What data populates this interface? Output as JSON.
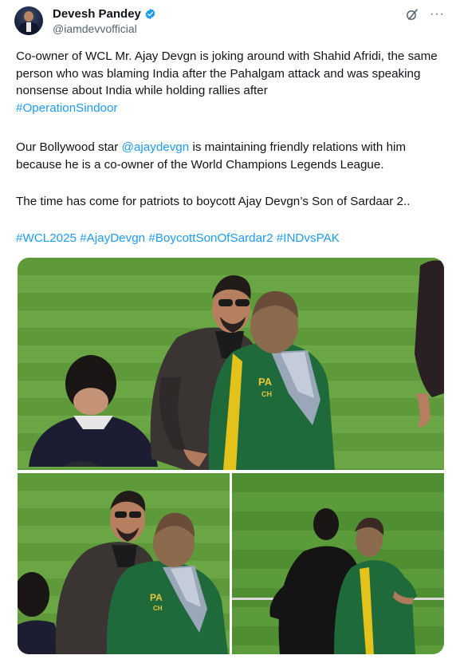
{
  "author": {
    "name": "Devesh Pandey",
    "handle": "@iamdevvofficial",
    "verified_icon": "verified-badge-icon",
    "colors": {
      "verified": "#1d9bf0",
      "link": "#1d9bf0",
      "text": "#0f1419",
      "muted": "#536471"
    }
  },
  "header_actions": {
    "grok_icon": "grok-icon",
    "more_label": "···"
  },
  "tweet": {
    "p1_text": "Co-owner of WCL Mr. Ajay Devgn is joking around with Shahid Afridi, the same person who was blaming India after the Pahalgam attack and was speaking nonsense about India while holding rallies after",
    "p1_tag": "#OperationSindoor",
    "p2_pre": "Our Bollywood star",
    "p2_mention": "@ajaydevgn",
    "p2_post": "is maintaining friendly relations with him because he is a co-owner of the World Champions Legends League.",
    "p3_text": "The time has come for patriots to boycott Ajay Devgn’s Son of Sardaar 2..",
    "hashtags": [
      "#WCL2025",
      "#AjayDevgn",
      "#BoycottSonOfSardar2",
      "#INDvsPAK"
    ]
  },
  "media": {
    "photos": [
      "main-photo",
      "bottom-left-photo",
      "bottom-right-photo"
    ],
    "jersey_text": {
      "main_line1": "PA",
      "main_line2": "CH",
      "small_line1": "PA",
      "small_line2": "CH"
    }
  }
}
